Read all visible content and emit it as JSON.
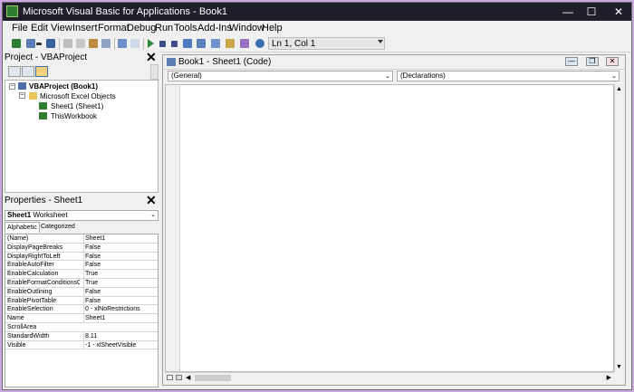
{
  "window": {
    "title": "Microsoft Visual Basic for Applications - Book1"
  },
  "menu": [
    "File",
    "Edit",
    "View",
    "Insert",
    "Format",
    "Debug",
    "Run",
    "Tools",
    "Add-Ins",
    "Window",
    "Help"
  ],
  "toolbar": {
    "position": "Ln 1, Col 1"
  },
  "project": {
    "title": "Project - VBAProject",
    "tree": {
      "root": "VBAProject (Book1)",
      "folder": "Microsoft Excel Objects",
      "items": [
        "Sheet1 (Sheet1)",
        "ThisWorkbook"
      ]
    }
  },
  "properties": {
    "title": "Properties - Sheet1",
    "object_name": "Sheet1",
    "object_type": "Worksheet",
    "tabs": [
      "Alphabetic",
      "Categorized"
    ],
    "rows": [
      {
        "name": "(Name)",
        "value": "Sheet1"
      },
      {
        "name": "DisplayPageBreaks",
        "value": "False"
      },
      {
        "name": "DisplayRightToLeft",
        "value": "False"
      },
      {
        "name": "EnableAutoFilter",
        "value": "False"
      },
      {
        "name": "EnableCalculation",
        "value": "True"
      },
      {
        "name": "EnableFormatConditionsCalc",
        "value": "True"
      },
      {
        "name": "EnableOutlining",
        "value": "False"
      },
      {
        "name": "EnablePivotTable",
        "value": "False"
      },
      {
        "name": "EnableSelection",
        "value": "0 - xlNoRestrictions"
      },
      {
        "name": "Name",
        "value": "Sheet1"
      },
      {
        "name": "ScrollArea",
        "value": ""
      },
      {
        "name": "StandardWidth",
        "value": "8.11"
      },
      {
        "name": "Visible",
        "value": "-1 - xlSheetVisible"
      }
    ]
  },
  "code": {
    "title": "Book1 - Sheet1 (Code)",
    "object_combo": "(General)",
    "proc_combo": "(Declarations)"
  }
}
